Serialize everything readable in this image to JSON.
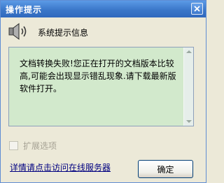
{
  "window": {
    "title": "操作提示"
  },
  "header": {
    "title": "系统提示信息",
    "icon": "speaker-icon"
  },
  "message": {
    "text": "文档转换失败!您正在打开的文档版本比较高,可能会出现显示错乱现象.请下载最新版软件打开。"
  },
  "expand": {
    "label": "扩展选项",
    "checked": false,
    "enabled": false
  },
  "footer": {
    "details_link": "详情请点击访问在线服务器",
    "ok_label": "确定"
  },
  "colors": {
    "titlebar": "#3b77c9",
    "message_bg": "#d2e9cc",
    "dialog_bg": "#ece9d8"
  }
}
